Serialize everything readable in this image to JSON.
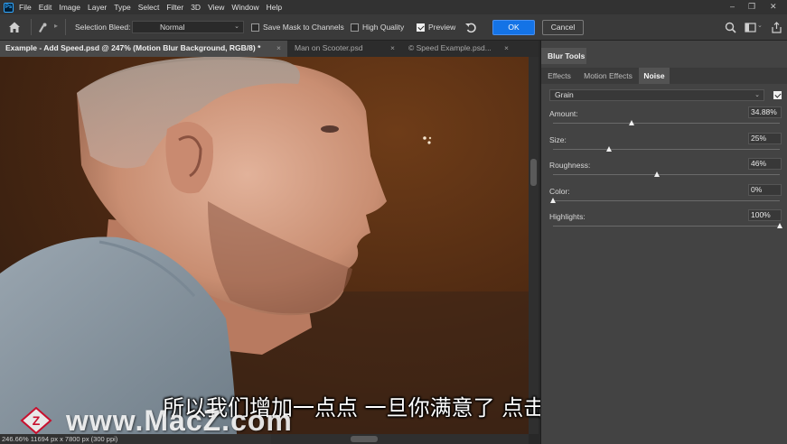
{
  "menu": {
    "logo": "Ps",
    "items": [
      "File",
      "Edit",
      "Image",
      "Layer",
      "Type",
      "Select",
      "Filter",
      "3D",
      "View",
      "Window",
      "Help"
    ],
    "window_controls": [
      "–",
      "❐",
      "✕"
    ]
  },
  "options_bar": {
    "selection_bleed_label": "Selection Bleed:",
    "bleed_mode": "Normal",
    "save_mask_label": "Save Mask to Channels",
    "save_mask_checked": false,
    "high_quality_label": "High Quality",
    "high_quality_checked": false,
    "preview_label": "Preview",
    "preview_checked": true,
    "ok_label": "OK",
    "cancel_label": "Cancel"
  },
  "tabs": [
    {
      "label": "Example - Add Speed.psd @ 247% (Motion Blur Background, RGB/8) *",
      "close": "×",
      "active": true
    },
    {
      "label": "Man on Scooter.psd",
      "close": "×",
      "active": false
    },
    {
      "label": "© Speed Example.psd...",
      "close": "×",
      "active": false
    }
  ],
  "status_bar": "246.66%  11694 px x 7800 px (300 ppi)",
  "panel": {
    "title": "Blur Tools",
    "subtabs": [
      {
        "label": "Effects",
        "active": false
      },
      {
        "label": "Motion Effects",
        "active": false
      },
      {
        "label": "Noise",
        "active": true
      }
    ],
    "noise_type": "Grain",
    "noise_enabled": true,
    "params": [
      {
        "label": "Amount:",
        "value": "34.88%",
        "fraction": 0.3488
      },
      {
        "label": "Size:",
        "value": "25%",
        "fraction": 0.25
      },
      {
        "label": "Roughness:",
        "value": "46%",
        "fraction": 0.46
      },
      {
        "label": "Color:",
        "value": "0%",
        "fraction": 0.0
      },
      {
        "label": "Highlights:",
        "value": "100%",
        "fraction": 1.0
      }
    ]
  },
  "subtitle": "所以我们增加一点点 一旦你满意了 点击确认",
  "watermark": {
    "logo_letter": "Z",
    "text": "www.MacZ.com"
  },
  "colors": {
    "accent": "#1473e6",
    "panel_bg": "#434343",
    "canvas_bg": "#4f2a12",
    "shirt": "#8d9aa6",
    "skin": "#d4a48a"
  }
}
